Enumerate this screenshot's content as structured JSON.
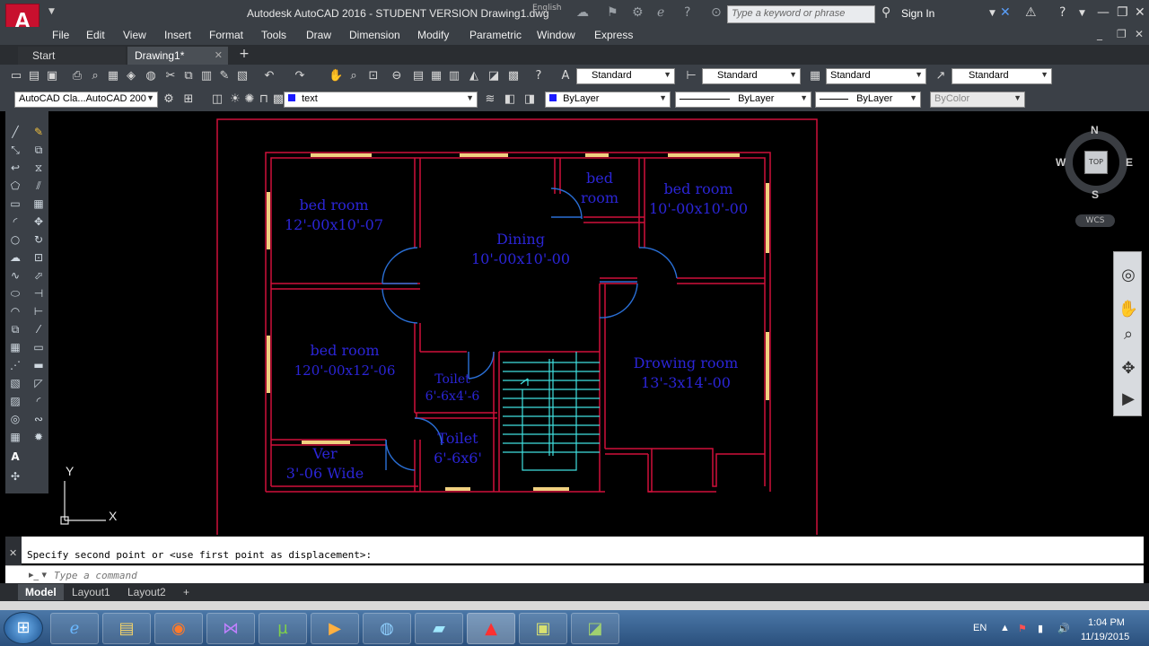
{
  "window": {
    "title": "Autodesk AutoCAD 2016 - STUDENT VERSION    Drawing1.dwg",
    "language": "English",
    "search_placeholder": "Type a keyword or phrase",
    "sign_in": "Sign In"
  },
  "menu": [
    "File",
    "Edit",
    "View",
    "Insert",
    "Format",
    "Tools",
    "Draw",
    "Dimension",
    "Modify",
    "Parametric",
    "Window",
    "Express"
  ],
  "tabs": [
    {
      "label": "Start"
    },
    {
      "label": "Drawing1*"
    }
  ],
  "styles": {
    "text_style": "Standard",
    "dim_style": "Standard",
    "table_style": "Standard",
    "mleader_style": "Standard"
  },
  "properties": {
    "workspace": "AutoCAD Cla...AutoCAD 200",
    "layer": "text",
    "color": "ByLayer",
    "linetype": "ByLayer",
    "lineweight": "ByLayer",
    "plotstyle": "ByColor"
  },
  "drawing": {
    "rooms": [
      {
        "name": "bed room",
        "size": "12'-00x10'-07"
      },
      {
        "name": "bed",
        "size": "room"
      },
      {
        "name": "bed room",
        "size": "10'-00x10'-00"
      },
      {
        "name": "Dining",
        "size": "10'-00x10'-00"
      },
      {
        "name": "bed room",
        "size": "120'-00x12'-06"
      },
      {
        "name": "Toilet",
        "size": "6'-6x4'-6"
      },
      {
        "name": "Drowing room",
        "size": "13'-3x14'-00"
      },
      {
        "name": "Toilet",
        "size": "6'-6x6'"
      },
      {
        "name": "Ver",
        "size": "3'-06 Wide"
      }
    ],
    "ucs": {
      "x": "X",
      "y": "Y"
    },
    "colors": {
      "walls": "#d0103a",
      "windows": "#f0d080",
      "doors": "#2a6fd6",
      "stairs": "#40e0e0",
      "text": "#2b25d6",
      "frame": "#d0103a"
    }
  },
  "viewcube": {
    "north": "N",
    "south": "S",
    "east": "E",
    "west": "W",
    "face": "TOP",
    "wcs": "WCS"
  },
  "command": {
    "history": "Specify second point or <use first point as displacement>:",
    "placeholder": "Type a command"
  },
  "layouts": [
    "Model",
    "Layout1",
    "Layout2"
  ],
  "tray": {
    "lang": "EN",
    "time": "1:04 PM",
    "date": "11/19/2015"
  }
}
